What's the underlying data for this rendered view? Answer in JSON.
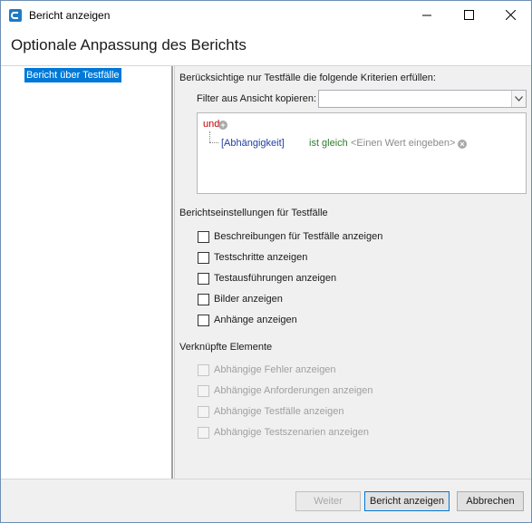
{
  "window": {
    "title": "Bericht anzeigen"
  },
  "header": {
    "title": "Optionale Anpassung des Berichts"
  },
  "nav": {
    "items": [
      {
        "label": "Bericht über Testfälle",
        "selected": true
      }
    ]
  },
  "filter": {
    "criteria_heading": "Berücksichtige nur Testfälle die folgende Kriterien erfüllen:",
    "copy_label": "Filter aus Ansicht kopieren:",
    "copy_value": "",
    "group_operator": "und",
    "criterion": {
      "field": "[Abhängigkeit]",
      "operator": "ist gleich",
      "value": "<Einen Wert eingeben>"
    }
  },
  "settings": {
    "heading": "Berichtseinstellungen für Testfälle",
    "options": [
      {
        "label": "Beschreibungen für Testfälle anzeigen",
        "checked": false
      },
      {
        "label": "Testschritte anzeigen",
        "checked": false
      },
      {
        "label": "Testausführungen anzeigen",
        "checked": false
      },
      {
        "label": "Bilder anzeigen",
        "checked": false
      },
      {
        "label": "Anhänge anzeigen",
        "checked": false
      }
    ]
  },
  "linked": {
    "heading": "Verknüpfte Elemente",
    "options": [
      {
        "label": "Abhängige Fehler anzeigen",
        "checked": false,
        "enabled": false
      },
      {
        "label": "Abhängige Anforderungen anzeigen",
        "checked": false,
        "enabled": false
      },
      {
        "label": "Abhängige Testfälle anzeigen",
        "checked": false,
        "enabled": false
      },
      {
        "label": "Abhängige Testszenarien anzeigen",
        "checked": false,
        "enabled": false
      }
    ]
  },
  "footer": {
    "next_label": "Weiter",
    "show_report_label": "Bericht anzeigen",
    "cancel_label": "Abbrechen"
  },
  "colors": {
    "selection": "#0078d7",
    "group_operator": "#c00000",
    "field": "#1f3fa8",
    "operator": "#2e7d2e"
  }
}
